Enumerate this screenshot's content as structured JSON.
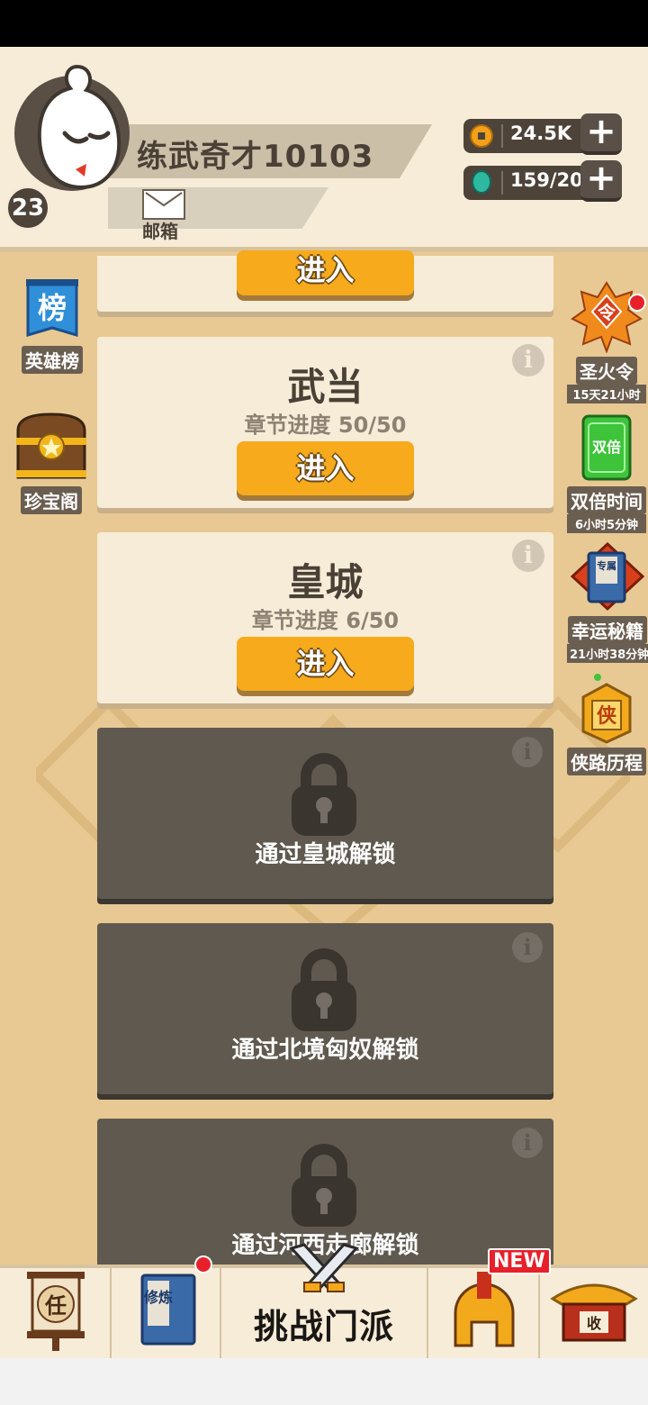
{
  "player": {
    "name": "练武奇才10103",
    "level": "23",
    "mail_label": "邮箱"
  },
  "resources": {
    "gold": "24.5K",
    "gems": "159/20"
  },
  "left_side": [
    {
      "label": "英雄榜",
      "icon_text": "榜"
    },
    {
      "label": "珍宝阁"
    }
  ],
  "right_side": [
    {
      "label": "圣火令",
      "sub": "15天21小时",
      "icon_text": "令"
    },
    {
      "label": "双倍时间",
      "sub": "6小时5分钟",
      "icon_text": "双倍"
    },
    {
      "label": "幸运秘籍",
      "sub": "21小时38分钟",
      "icon_text": "专属"
    },
    {
      "label": "侠路历程",
      "icon_text": "侠"
    }
  ],
  "sects": [
    {
      "enter_label": "进入"
    },
    {
      "title": "武当",
      "progress": "章节进度 50/50",
      "enter_label": "进入",
      "info": "i"
    },
    {
      "title": "皇城",
      "progress": "章节进度 6/50",
      "enter_label": "进入",
      "info": "i"
    }
  ],
  "locked": [
    {
      "text": "通过皇城解锁",
      "info": "i"
    },
    {
      "text": "通过北境匈奴解锁",
      "info": "i"
    },
    {
      "text": "通过河西走廊解锁",
      "info": "i"
    }
  ],
  "nav": {
    "task_icon_text": "任",
    "cultivate_icon_text": "修炼",
    "challenge_label": "挑战门派",
    "new_badge": "NEW",
    "collect_icon_text": "收"
  },
  "colors": {
    "accent": "#f6aa1c",
    "card_bg": "#f6ecd8",
    "locked_bg": "#605950",
    "background": "#e8c993"
  }
}
